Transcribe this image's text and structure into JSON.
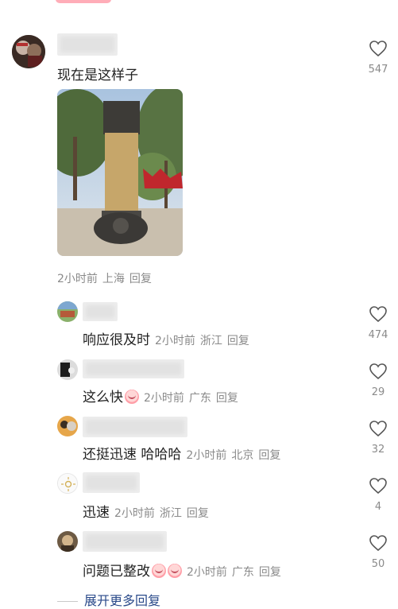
{
  "main_comment": {
    "text": "现在是这样子",
    "likes": "547",
    "time": "2小时前",
    "location": "上海",
    "reply_label": "回复"
  },
  "replies": [
    {
      "text": "响应很及时",
      "time": "2小时前",
      "location": "浙江",
      "reply_label": "回复",
      "likes": "474",
      "emoji_count": 0
    },
    {
      "text": "这么快",
      "time": "2小时前",
      "location": "广东",
      "reply_label": "回复",
      "likes": "29",
      "emoji_count": 1
    },
    {
      "text": "还挺迅速 哈哈哈",
      "time": "2小时前",
      "location": "北京",
      "reply_label": "回复",
      "likes": "32",
      "emoji_count": 0
    },
    {
      "text": "迅速",
      "time": "2小时前",
      "location": "浙江",
      "reply_label": "回复",
      "likes": "4",
      "emoji_count": 0
    },
    {
      "text": "问题已整改",
      "time": "2小时前",
      "location": "广东",
      "reply_label": "回复",
      "likes": "50",
      "emoji_count": 2
    }
  ],
  "expand_more": "展开更多回复",
  "icons": {
    "like": "heart-outline-icon",
    "emoji": "laughing-tears-emoji"
  }
}
